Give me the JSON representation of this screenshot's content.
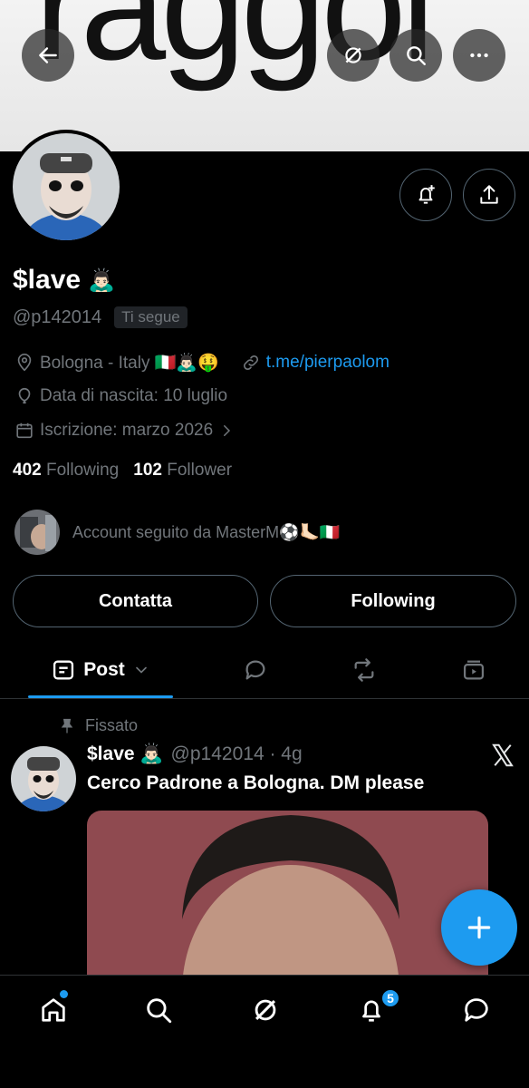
{
  "banner": {
    "text": "raggol"
  },
  "profile": {
    "name": "$lave",
    "name_emoji": "🙇🏻‍♂️",
    "handle": "@p142014",
    "follows_you": "Ti segue",
    "location": "Bologna - Italy 🇮🇹🙇🏻‍♂️🤑",
    "link": "t.me/pierpaolom",
    "birth": "Data di nascita: 10 luglio",
    "joined": "Iscrizione: marzo 2026",
    "following_count": "402",
    "following_label": "Following",
    "follower_count": "102",
    "follower_label": "Follower",
    "followed_by": "Account seguito da MasterM⚽️🦶🏻🇮🇹"
  },
  "actions": {
    "contact": "Contatta",
    "following": "Following"
  },
  "tabs": {
    "post": "Post"
  },
  "post": {
    "pinned": "Fissato",
    "name": "$lave 🙇🏻‍♂️",
    "meta": "@p142014 · 4g",
    "text": "Cerco Padrone a Bologna. DM please"
  },
  "nav": {
    "notifications_badge": "5"
  },
  "colors": {
    "accent": "#1d9bf0",
    "background": "#000000",
    "muted": "#71767b"
  }
}
